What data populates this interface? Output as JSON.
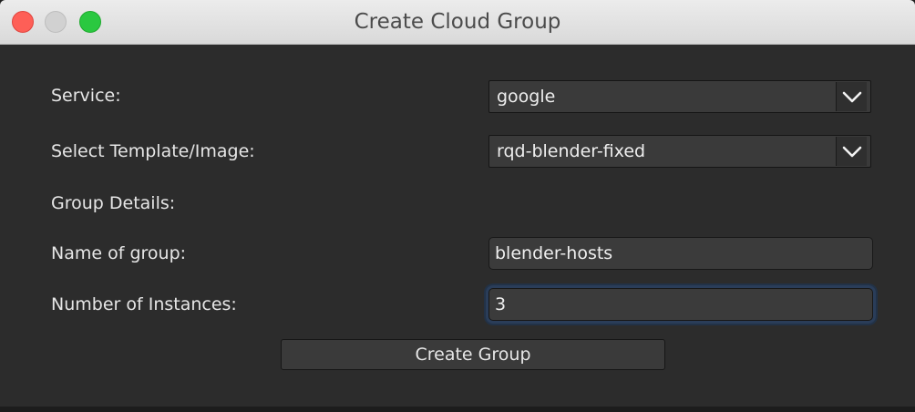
{
  "window": {
    "title": "Create Cloud Group"
  },
  "form": {
    "service_label": "Service:",
    "service_value": "google",
    "template_label": "Select Template/Image:",
    "template_value": "rqd-blender-fixed",
    "group_details_label": "Group Details:",
    "group_name_label": "Name of group:",
    "group_name_value": "blender-hosts",
    "instances_label": "Number of Instances:",
    "instances_value": "3",
    "submit_label": "Create Group"
  },
  "colors": {
    "window_bg": "#2c2c2c",
    "close": "#fe5f57",
    "minimize": "#d1d1d1",
    "maximize": "#2ac840",
    "focus_ring": "#2a3d59"
  },
  "icons": {
    "dropdown": "chevron-down-icon"
  }
}
